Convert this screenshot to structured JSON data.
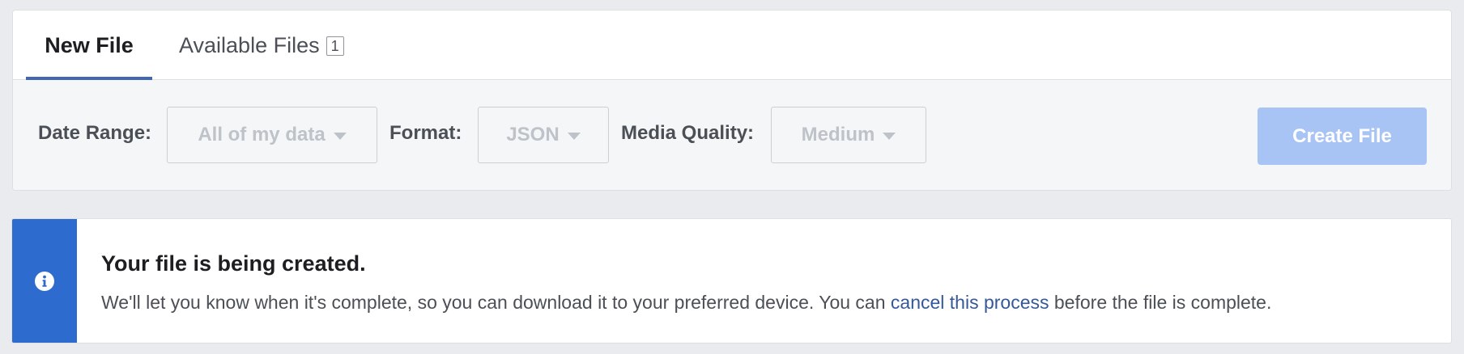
{
  "tabs": {
    "new_file": "New File",
    "available_files": "Available Files",
    "available_count": "1"
  },
  "toolbar": {
    "date_range_label": "Date Range:",
    "date_range_value": "All of my data",
    "format_label": "Format:",
    "format_value": "JSON",
    "media_quality_label": "Media Quality:",
    "media_quality_value": "Medium",
    "create_button": "Create File",
    "create_button_enabled": false
  },
  "notice": {
    "icon": "info-icon",
    "title": "Your file is being created.",
    "body_before": "We'll let you know when it's complete, so you can download it to your preferred device. You can ",
    "link_text": "cancel this process",
    "body_after": " before the file is complete."
  },
  "colors": {
    "accent": "#4267b2",
    "notice_strip": "#2d6bcf",
    "link": "#365899",
    "disabled_button": "#a8c4f5"
  }
}
